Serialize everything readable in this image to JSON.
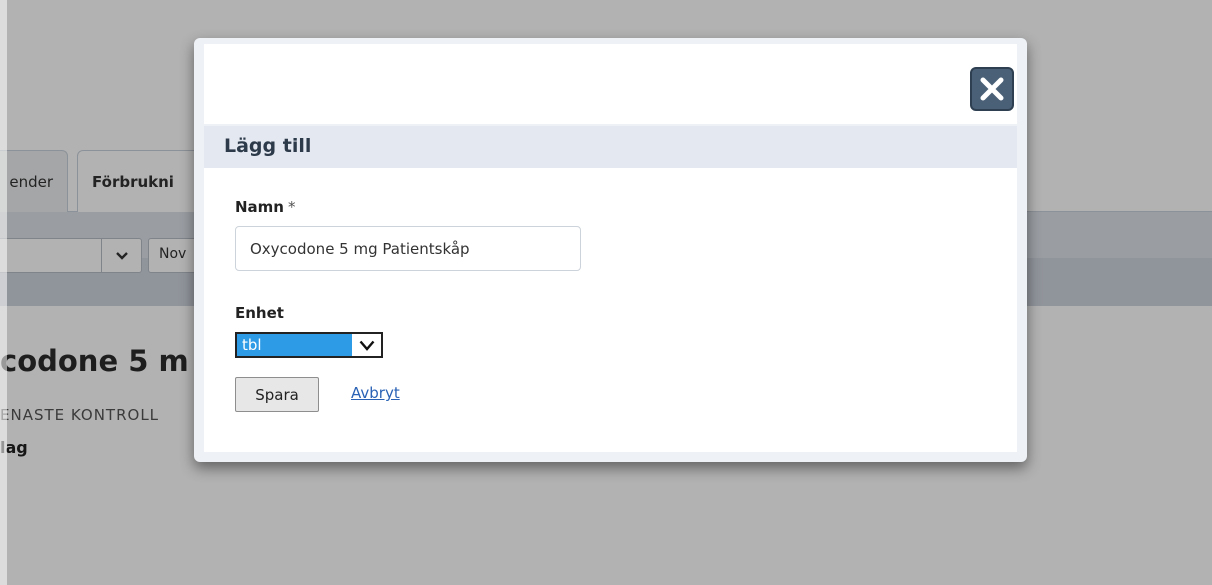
{
  "background": {
    "tabs": [
      {
        "label": "ender"
      },
      {
        "label": "Förbrukni"
      }
    ],
    "toolbar": {
      "select_b_text": "Nov"
    },
    "item_title": "codone 5 m",
    "subtitle": "ENASTE KONTROLL",
    "bold_text": "lag"
  },
  "modal": {
    "title": "Lägg till",
    "close_icon": "close-icon",
    "name_label": "Namn",
    "required_marker": "*",
    "name_value": "Oxycodone 5 mg Patientskåp",
    "unit_label": "Enhet",
    "unit_value": "tbl",
    "save_label": "Spara",
    "cancel_label": "Avbryt"
  },
  "colors": {
    "overlay": "#b3b3b3",
    "close_button": "#4a6077",
    "select_highlight": "#2d9be6",
    "link": "#2a62b5",
    "title_bar": "#e4e8f0"
  }
}
